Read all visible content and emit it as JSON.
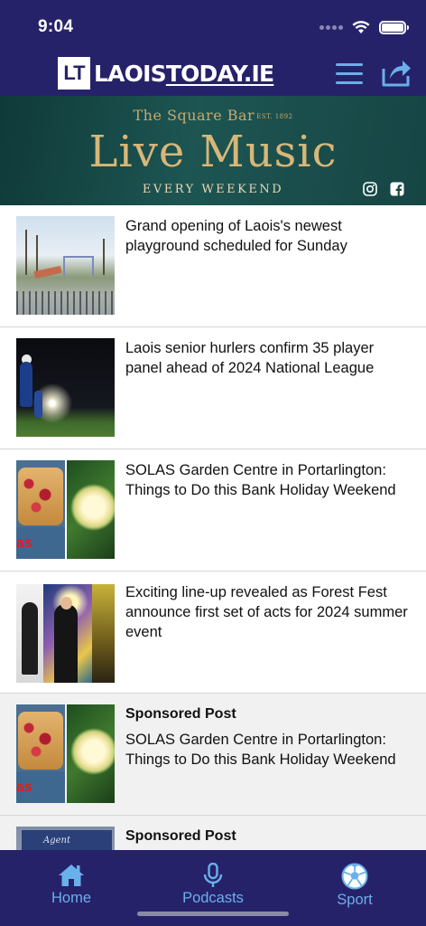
{
  "status_bar": {
    "time": "9:04"
  },
  "header": {
    "logo_mark": "LT",
    "logo_text_a": "LAOIS",
    "logo_text_b": "TODAY",
    "logo_text_c": ".IE",
    "menu_icon": "hamburger-menu-icon",
    "share_icon": "share-icon"
  },
  "banner": {
    "venue": "The Square Bar",
    "venue_small": "EST. 1892",
    "headline": "Live Music",
    "subline": "EVERY WEEKEND",
    "icons": [
      "instagram-icon",
      "facebook-icon"
    ]
  },
  "feed": {
    "items": [
      {
        "sponsored": "",
        "title": "Grand opening of Laois's newest playground scheduled for Sunday",
        "thumb": "playground"
      },
      {
        "sponsored": "",
        "title": "Laois senior hurlers confirm 35 player panel ahead of 2024 National League",
        "thumb": "hurlers"
      },
      {
        "sponsored": "",
        "title": "SOLAS Garden Centre in Portarlington: Things to Do this Bank Holiday Weekend",
        "thumb": "garden",
        "thumb_tag": "as"
      },
      {
        "sponsored": "",
        "title": "Exciting line-up revealed as Forest Fest announce first set of acts for 2024 summer event",
        "thumb": "festival"
      },
      {
        "sponsored": "Sponsored Post",
        "title": "SOLAS Garden Centre in Portarlington: Things to Do this Bank Holiday Weekend",
        "thumb": "garden",
        "thumb_tag": "as"
      },
      {
        "sponsored": "Sponsored Post",
        "title": "",
        "thumb": "building",
        "thumb_sign": "Agent"
      }
    ]
  },
  "tabbar": {
    "tabs": [
      {
        "label": "Home",
        "icon": "home-icon"
      },
      {
        "label": "Podcasts",
        "icon": "microphone-icon"
      },
      {
        "label": "Sport",
        "icon": "soccer-ball-icon"
      }
    ]
  },
  "colors": {
    "header_bg": "#26226a",
    "accent": "#6ab0ea",
    "banner_gold": "#d7b779",
    "banner_bg": "#1d5552"
  }
}
